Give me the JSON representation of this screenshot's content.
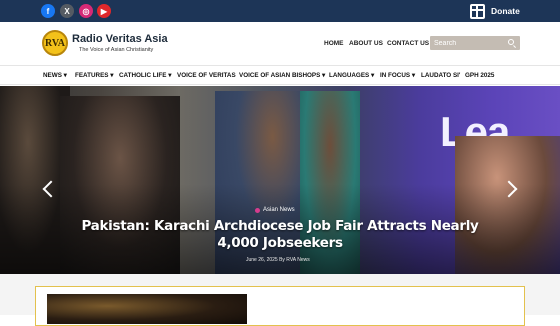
{
  "top_bar": {
    "social": [
      {
        "name": "facebook",
        "glyph": "f"
      },
      {
        "name": "x",
        "glyph": "X"
      },
      {
        "name": "instagram",
        "glyph": "◎"
      },
      {
        "name": "youtube",
        "glyph": "▶"
      }
    ],
    "donate_label": "Donate"
  },
  "header": {
    "logo_mark": "RVA",
    "site_title": "Radio Veritas Asia",
    "tagline": "The Voice of Asian Christianity",
    "nav": [
      "HOME",
      "ABOUT US",
      "CONTACT US"
    ],
    "search_placeholder": "Search"
  },
  "main_nav": [
    {
      "label": "NEWS",
      "dropdown": true
    },
    {
      "label": "FEATURES",
      "dropdown": true
    },
    {
      "label": "CATHOLIC LIFE",
      "dropdown": true
    },
    {
      "label": "VOICE OF VERITAS",
      "dropdown": false
    },
    {
      "label": "VOICE OF ASIAN BISHOPS",
      "dropdown": true
    },
    {
      "label": "LANGUAGES",
      "dropdown": true
    },
    {
      "label": "IN FOCUS",
      "dropdown": true
    },
    {
      "label": "LAUDATO SI'",
      "dropdown": false
    },
    {
      "label": "GPH 2025",
      "dropdown": false
    }
  ],
  "hero": {
    "category": "Asian News",
    "title": "Pakistan: Karachi Archdiocese Job Fair Attracts Nearly 4,000 Jobseekers",
    "meta": "June 26, 2025 By RVA News",
    "background_word": "Lea"
  },
  "colors": {
    "top_bar": "#1d3557",
    "search_bg": "#c4bcb3",
    "card_border": "#e3c14d"
  }
}
